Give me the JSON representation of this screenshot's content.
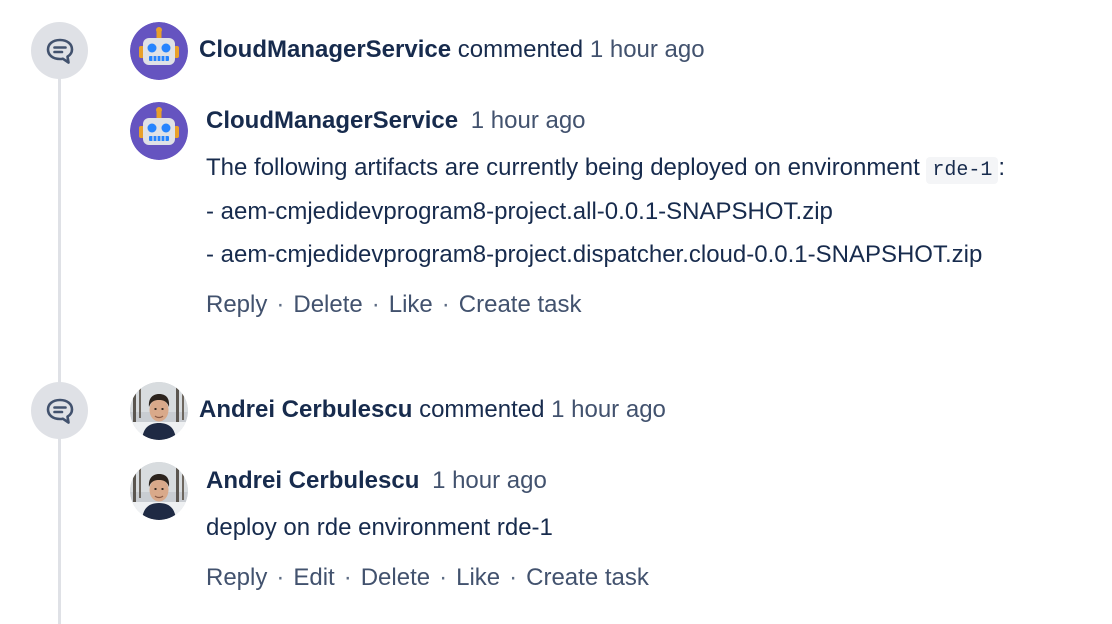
{
  "activity": [
    {
      "author": "CloudManagerService",
      "verb": "commented",
      "time": "1 hour ago",
      "comment": {
        "author": "CloudManagerService",
        "time": "1 hour ago",
        "body_prefix": "The following artifacts are currently being deployed on environment",
        "body_code": "rde-1",
        "body_suffix": ":",
        "lines": [
          "- aem-cmjedidevprogram8-project.all-0.0.1-SNAPSHOT.zip",
          "- aem-cmjedidevprogram8-project.dispatcher.cloud-0.0.1-SNAPSHOT.zip"
        ],
        "actions": [
          "Reply",
          "Delete",
          "Like",
          "Create task"
        ]
      }
    },
    {
      "author": "Andrei Cerbulescu",
      "verb": "commented",
      "time": "1 hour ago",
      "comment": {
        "author": "Andrei Cerbulescu",
        "time": "1 hour ago",
        "body": "deploy on rde environment rde-1",
        "actions": [
          "Reply",
          "Edit",
          "Delete",
          "Like",
          "Create task"
        ]
      }
    }
  ],
  "separator": "·",
  "icons": {
    "timeline": "comment-bubble-icon",
    "bot_avatar": "robot-avatar",
    "user_avatar": "user-photo-avatar"
  },
  "colors": {
    "text": "#172b4d",
    "muted": "#42526e",
    "timeline": "#dfe1e6",
    "bot_avatar_bg": "#6554c0"
  }
}
